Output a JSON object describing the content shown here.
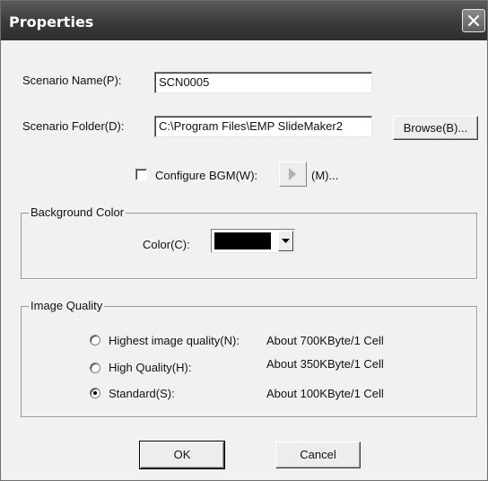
{
  "window": {
    "title": "Properties"
  },
  "scenario_name": {
    "label": "Scenario Name(P):",
    "value": "SCN0005"
  },
  "scenario_folder": {
    "label": "Scenario Folder(D):",
    "value": "C:\\Program Files\\EMP SlideMaker2",
    "browse_label": "Browse(B)..."
  },
  "bgm": {
    "label": "Configure BGM(W):",
    "checked": false,
    "music_label": "(M)..."
  },
  "background_color": {
    "group_title": "Background Color",
    "color_label": "Color(C):",
    "color_value": "#000000"
  },
  "image_quality": {
    "group_title": "Image Quality",
    "options": [
      {
        "label": "Highest image quality(N):",
        "size": "About 700KByte/1 Cell",
        "selected": false
      },
      {
        "label": "High Quality(H):",
        "size": "About 350KByte/1 Cell",
        "selected": false
      },
      {
        "label": "Standard(S):",
        "size": "About 100KByte/1 Cell",
        "selected": true
      }
    ]
  },
  "buttons": {
    "ok": "OK",
    "cancel": "Cancel"
  }
}
